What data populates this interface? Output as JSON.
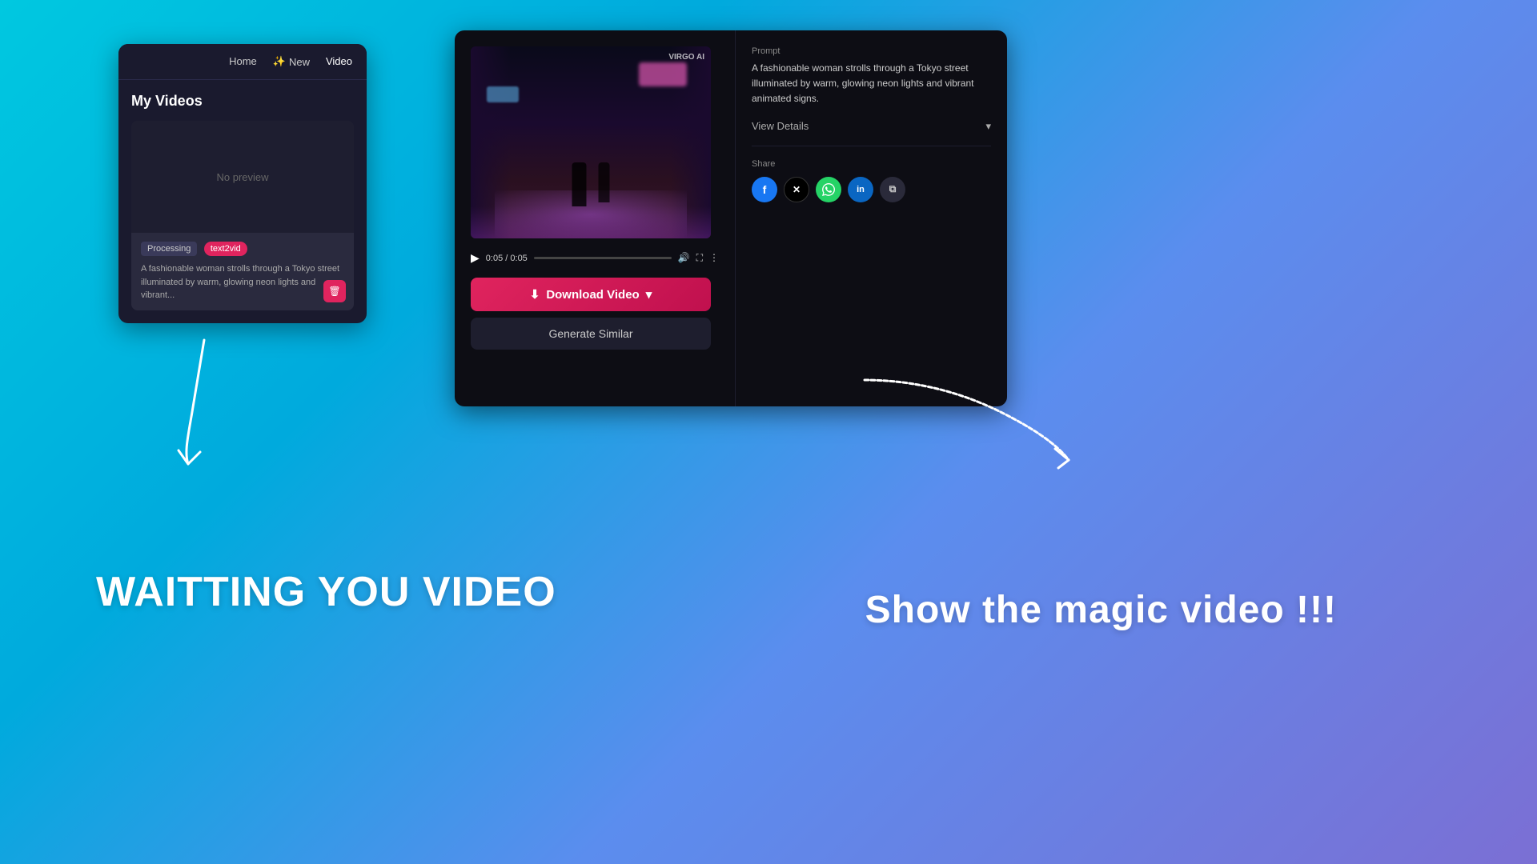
{
  "background": {
    "gradient_start": "#00c8e0",
    "gradient_end": "#7b6fd4"
  },
  "left_panel": {
    "nav": {
      "home": "Home",
      "new_icon": "✨",
      "new": "New",
      "video": "Video"
    },
    "title": "My Videos",
    "video_card": {
      "no_preview": "No preview",
      "status": "Processing",
      "tag": "text2vid",
      "description": "A fashionable woman strolls through a Tokyo street illuminated by warm, glowing neon lights and vibrant..."
    }
  },
  "left_annotation": "WAITTING YOU VIDEO",
  "right_panel": {
    "prompt_label": "Prompt",
    "prompt_text": "A fashionable woman strolls through a Tokyo street illuminated by warm, glowing neon lights and vibrant animated signs.",
    "view_details": "View Details",
    "share_label": "Share",
    "share_options": [
      "Facebook",
      "X (Twitter)",
      "WhatsApp",
      "LinkedIn",
      "Copy"
    ],
    "watermark": "VIRGO AI",
    "time_current": "0:05",
    "time_total": "0:05",
    "download_btn": "Download Video",
    "generate_btn": "Generate Similar"
  },
  "right_annotation": "Show the magic video !!!",
  "icons": {
    "download": "⬇",
    "chevron_down": "▾",
    "play": "▶",
    "volume": "🔊",
    "fullscreen": "⛶",
    "more": "⋮",
    "delete": "🗑",
    "star": "✨"
  }
}
